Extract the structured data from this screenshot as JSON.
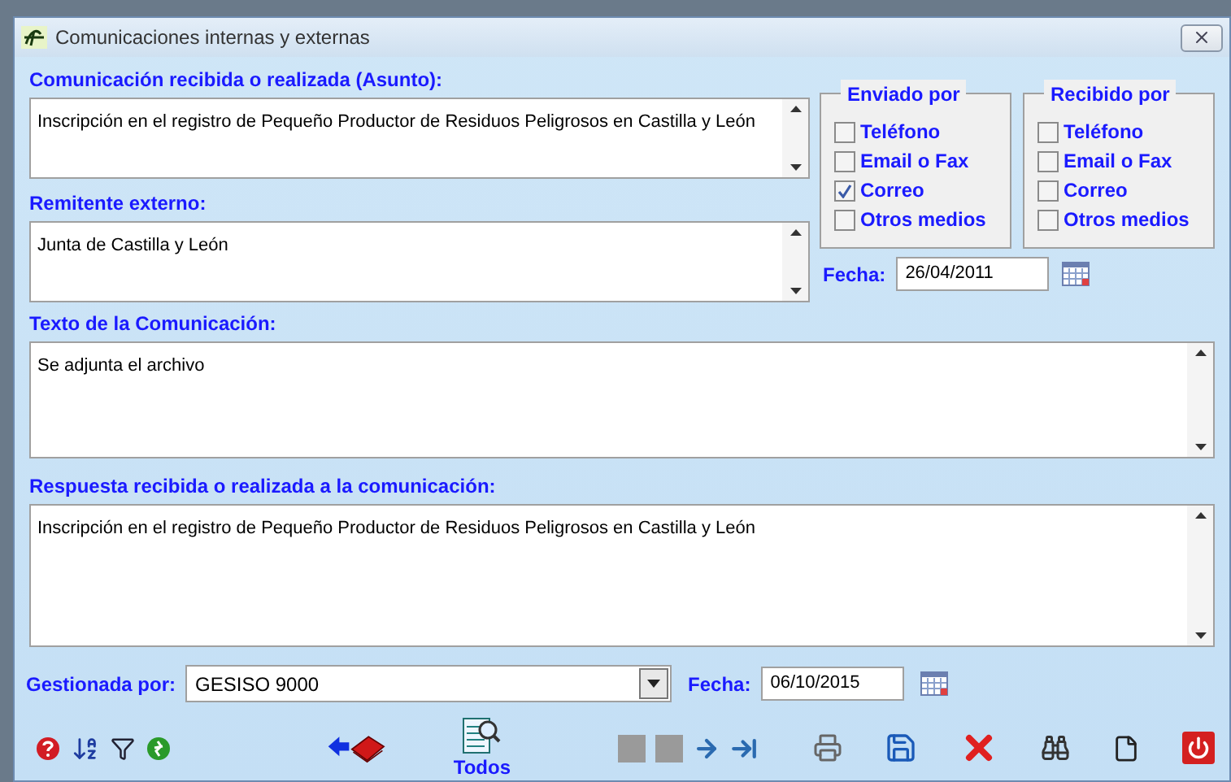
{
  "window": {
    "title": "Comunicaciones internas y externas"
  },
  "asunto": {
    "label": "Comunicación recibida o realizada  (Asunto):",
    "value": "Inscripción en el registro de Pequeño Productor de Residuos Peligrosos en Castilla y León"
  },
  "remitente": {
    "label": "Remitente externo:",
    "value": "Junta de Castilla y León"
  },
  "enviado_por": {
    "title": "Enviado por",
    "options": [
      {
        "label": "Teléfono",
        "checked": false
      },
      {
        "label": "Email o Fax",
        "checked": false
      },
      {
        "label": "Correo",
        "checked": true
      },
      {
        "label": "Otros medios",
        "checked": false
      }
    ]
  },
  "recibido_por": {
    "title": "Recibido por",
    "options": [
      {
        "label": "Teléfono",
        "checked": false
      },
      {
        "label": "Email o Fax",
        "checked": false
      },
      {
        "label": "Correo",
        "checked": false
      },
      {
        "label": "Otros medios",
        "checked": false
      }
    ]
  },
  "fecha": {
    "label": "Fecha:",
    "value": "26/04/2011"
  },
  "texto": {
    "label": "Texto de la Comunicación:",
    "value": "Se adjunta el archivo"
  },
  "respuesta": {
    "label": "Respuesta recibida o realizada a la comunicación:",
    "value": "Inscripción en el registro de Pequeño Productor de Residuos Peligrosos en Castilla y León"
  },
  "gestionada": {
    "label": "Gestionada por:",
    "value": "GESISO 9000"
  },
  "fecha_gestion": {
    "label": "Fecha:",
    "value": "06/10/2015"
  },
  "toolbar": {
    "todos_label": "Todos"
  }
}
